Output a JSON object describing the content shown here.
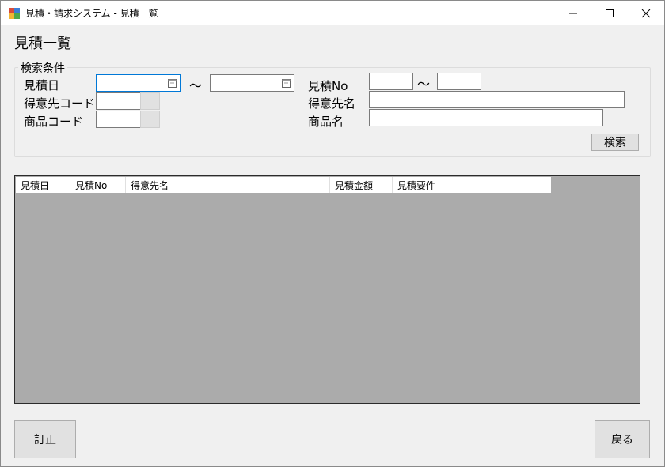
{
  "window": {
    "title": "見積・請求システム - 見積一覧",
    "icon": "app-window-icon"
  },
  "page": {
    "title": "見積一覧"
  },
  "search": {
    "group_label": "検索条件",
    "estimate_date_label": "見積日",
    "estimate_date_from": "",
    "estimate_date_to": "",
    "range_sep_1": "～",
    "estimate_no_label": "見積No",
    "estimate_no_from": "",
    "estimate_no_to": "",
    "range_sep_2": "～",
    "customer_code_label": "得意先コード",
    "customer_code": "",
    "customer_name_label": "得意先名",
    "customer_name": "",
    "product_code_label": "商品コード",
    "product_code": "",
    "product_name_label": "商品名",
    "product_name": "",
    "search_button": "検索"
  },
  "grid": {
    "columns": [
      "見積日",
      "見積No",
      "得意先名",
      "見積金額",
      "見積要件"
    ],
    "rows": []
  },
  "footer": {
    "correct_button": "訂正",
    "back_button": "戻る"
  }
}
